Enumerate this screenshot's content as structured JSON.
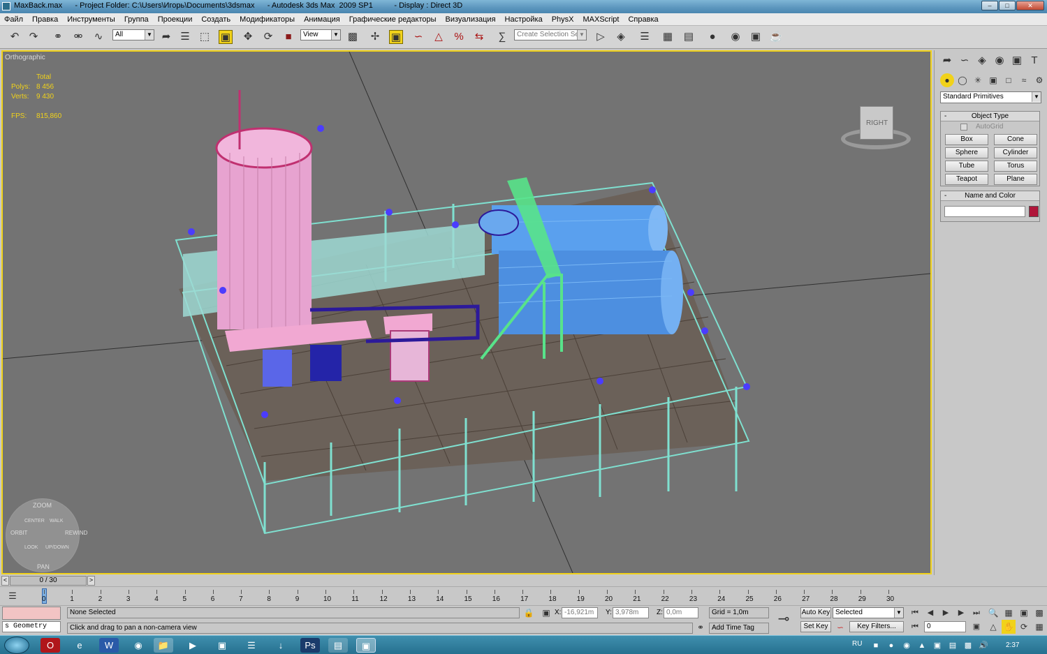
{
  "window": {
    "title": "MaxBack.max      - Project Folder: C:\\Users\\Игорь\\Documents\\3dsmax      - Autodesk 3ds Max  2009 SP1          - Display : Direct 3D"
  },
  "menu": [
    "Файл",
    "Правка",
    "Инструменты",
    "Группа",
    "Проекции",
    "Создать",
    "Модификаторы",
    "Анимация",
    "Графические редакторы",
    "Визуализация",
    "Настройка",
    "PhysX",
    "MAXScript",
    "Справка"
  ],
  "toolbar": {
    "filter_value": "All",
    "refcoord_value": "View",
    "selection_set_placeholder": "Create Selection Set"
  },
  "viewport": {
    "label": "Orthographic",
    "stats_header": "Total",
    "polys_label": "Polys:",
    "polys_value": "8 456",
    "verts_label": "Verts:",
    "verts_value": "9 430",
    "fps_label": "FPS:",
    "fps_value": "815,860",
    "viewcube_label": "RIGHT",
    "wheel": {
      "zoom": "ZOOM",
      "orbit": "ORBIT",
      "center": "CENTER",
      "walk": "WALK",
      "rewind": "REWIND",
      "look": "LOOK",
      "updown": "UP/DOWN",
      "pan": "PAN"
    }
  },
  "command_panel": {
    "category_value": "Standard Primitives",
    "object_type_title": "Object Type",
    "autogrid_label": "AutoGrid",
    "buttons": [
      "Box",
      "Cone",
      "Sphere",
      "Cylinder",
      "Tube",
      "Torus",
      "Teapot",
      "Plane"
    ],
    "name_color_title": "Name and Color",
    "name_value": "",
    "object_color": "#b0163a"
  },
  "timeline": {
    "frame_counter": "0 / 30",
    "ticks": [
      "0",
      "1",
      "2",
      "3",
      "4",
      "5",
      "6",
      "7",
      "8",
      "9",
      "10",
      "11",
      "12",
      "13",
      "14",
      "15",
      "16",
      "17",
      "18",
      "19",
      "20",
      "21",
      "22",
      "23",
      "24",
      "25",
      "26",
      "27",
      "28",
      "29",
      "30"
    ]
  },
  "status": {
    "script_label": "s Geometry",
    "selection_status": "None Selected",
    "prompt": "Click and drag to pan a non-camera view",
    "x_label": "X:",
    "x_value": "-16,921m",
    "y_label": "Y:",
    "y_value": "3,978m",
    "z_label": "Z:",
    "z_value": "0,0m",
    "grid": "Grid = 1,0m",
    "add_time_tag": "Add Time Tag",
    "auto_key": "Auto Key",
    "set_key": "Set Key",
    "key_mode_value": "Selected",
    "key_filters": "Key Filters...",
    "current_frame": "0"
  },
  "taskbar": {
    "language": "RU",
    "clock": "2:37"
  },
  "colors": {
    "accent": "#f1d21a",
    "viewport_bg": "#737373",
    "wire": "#7fe0d0",
    "handles": "#4b3cff",
    "tank_pink": "#e7a3d0",
    "tank_blue": "#5aa0ee",
    "rail_green": "#58e38a"
  }
}
